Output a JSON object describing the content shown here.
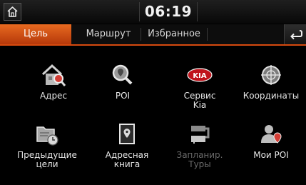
{
  "status": {
    "time": "06:19",
    "home_icon": "home-icon"
  },
  "tabs": [
    {
      "label": "Цель",
      "active": true
    },
    {
      "label": "Маршрут",
      "active": false
    },
    {
      "label": "Избранное",
      "active": false
    }
  ],
  "back_icon": "back-arrow-icon",
  "menu": {
    "address": {
      "label": "Адрес",
      "icon": "house-magnifier-icon"
    },
    "poi": {
      "label": "POI",
      "icon": "magnifier-pin-icon"
    },
    "kia_service": {
      "label": "Сервис\nKia",
      "icon": "kia-logo-icon"
    },
    "coordinates": {
      "label": "Координаты",
      "icon": "crosshair-globe-icon"
    },
    "previous": {
      "label": "Предыдущие\nцели",
      "icon": "folder-clock-icon"
    },
    "address_book": {
      "label": "Адресная\nкнига",
      "icon": "book-pin-icon"
    },
    "planned_tours": {
      "label": "Запланир.\nТуры",
      "icon": "route-flag-icon",
      "disabled": true
    },
    "my_poi": {
      "label": "Мои POI",
      "icon": "person-pin-icon"
    }
  },
  "colors": {
    "accent": "#d64a0f",
    "kia_red": "#c0141c",
    "background": "#000000"
  }
}
